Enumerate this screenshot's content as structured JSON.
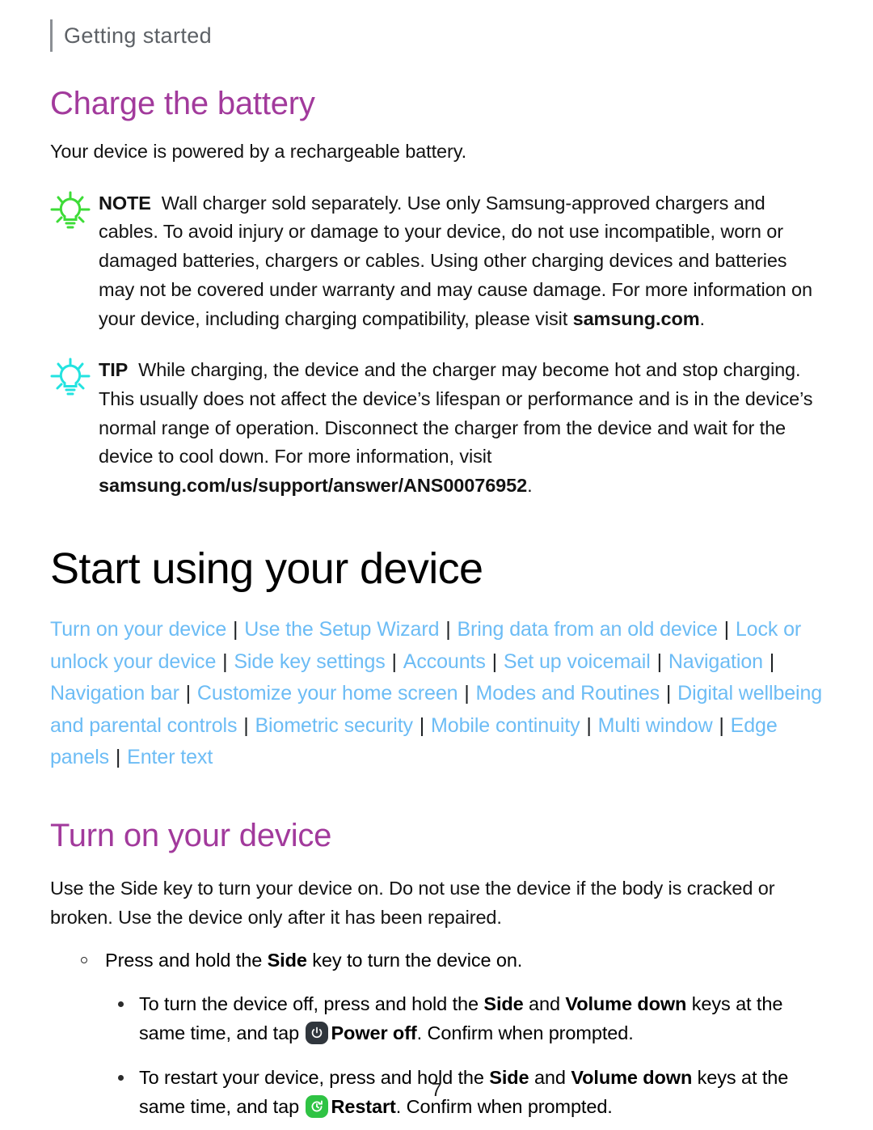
{
  "header": {
    "running_head": "Getting started"
  },
  "charge_section": {
    "title": "Charge the battery",
    "intro": "Your device is powered by a rechargeable battery.",
    "note": {
      "label": "NOTE",
      "icon": "lightbulb-icon",
      "icon_color": "#3ddc37",
      "text": "Wall charger sold separately. Use only Samsung-approved chargers and cables. To avoid injury or damage to your device, do not use incompatible, worn or damaged batteries, chargers or cables. Using other charging devices and batteries may not be covered under warranty and may cause damage. For more information on your device, including charging compatibility, please visit ",
      "bold_tail": "samsung.com",
      "tail_punct": "."
    },
    "tip": {
      "label": "TIP",
      "icon": "lightbulb-icon",
      "icon_color": "#22e3e0",
      "text": "While charging, the device and the charger may become hot and stop charging. This usually does not affect the device’s lifespan or performance and is in the device’s normal range of operation. Disconnect the charger from the device and wait for the device to cool down. For more information, visit ",
      "bold_tail": "samsung.com/us/support/answer/ANS00076952",
      "tail_punct": "."
    }
  },
  "start_section": {
    "title": "Start using your device",
    "link_color": "#6cbcf5",
    "links": [
      "Turn on your device",
      "Use the Setup Wizard",
      "Bring data from an old device",
      "Lock or unlock your device",
      "Side key settings",
      "Accounts",
      "Set up voicemail",
      "Navigation",
      "Navigation bar",
      "Customize your home screen",
      "Modes and Routines",
      "Digital wellbeing and parental controls",
      "Biometric security",
      "Mobile continuity",
      "Multi window",
      "Edge panels",
      "Enter text"
    ],
    "separator": "|"
  },
  "turn_on_section": {
    "title": "Turn on your device",
    "paragraph": "Use the Side key to turn your device on. Do not use the device if the body is cracked or broken. Use the device only after it has been repaired.",
    "bullet_primary": {
      "pre": "Press and hold the ",
      "bold": "Side",
      "post": " key to turn the device on."
    },
    "sub_bullets": [
      {
        "p1": "To turn the device off, press and hold the ",
        "b1": "Side",
        "p2": " and ",
        "b2": "Volume down",
        "p3": " keys at the same time, and tap ",
        "icon": "power-off-icon",
        "icon_color": "#30363d",
        "b3": "Power off",
        "p4": ". Confirm when prompted."
      },
      {
        "p1": "To restart your device, press and hold the ",
        "b1": "Side",
        "p2": " and ",
        "b2": "Volume down",
        "p3": " keys at the same time, and tap ",
        "icon": "restart-icon",
        "icon_color": "#2fc344",
        "b3": "Restart",
        "p4": ". Confirm when prompted."
      }
    ]
  },
  "footer": {
    "page_number": "7"
  }
}
